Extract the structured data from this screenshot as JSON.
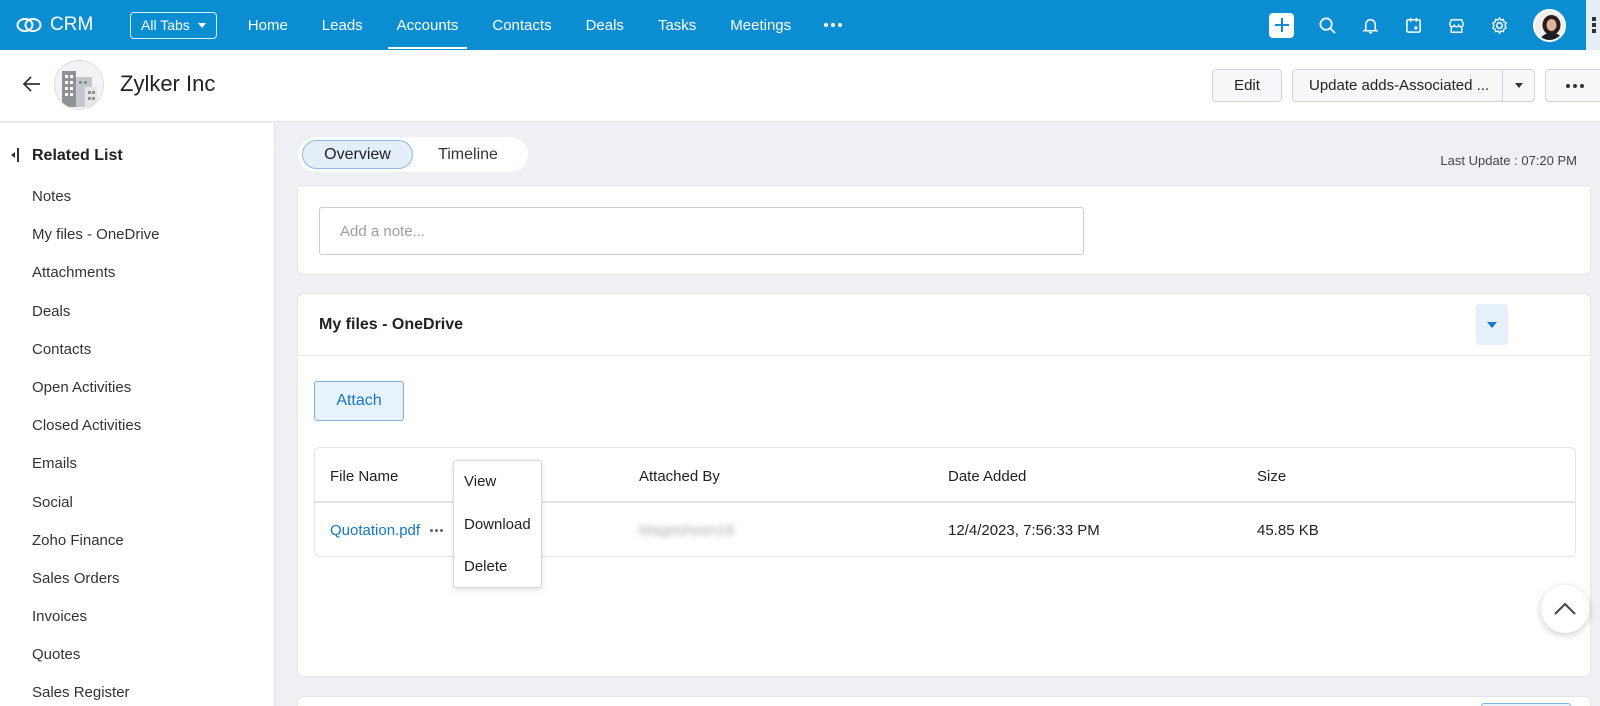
{
  "app": {
    "name": "CRM"
  },
  "nav": {
    "all_tabs": "All Tabs",
    "items": [
      "Home",
      "Leads",
      "Accounts",
      "Contacts",
      "Deals",
      "Tasks",
      "Meetings"
    ],
    "active": "Accounts"
  },
  "record": {
    "name": "Zylker Inc",
    "edit_label": "Edit",
    "update_label": "Update adds-Associated ..."
  },
  "sidebar": {
    "title": "Related List",
    "items": [
      "Notes",
      "My files - OneDrive",
      "Attachments",
      "Deals",
      "Contacts",
      "Open Activities",
      "Closed Activities",
      "Emails",
      "Social",
      "Zoho Finance",
      "Sales Orders",
      "Invoices",
      "Quotes",
      "Sales Register"
    ]
  },
  "tabs": {
    "overview": "Overview",
    "timeline": "Timeline"
  },
  "last_update": "Last Update : 07:20 PM",
  "note": {
    "placeholder": "Add a note..."
  },
  "files_section": {
    "title": "My files - OneDrive",
    "attach_label": "Attach",
    "columns": [
      "File Name",
      "Attached By",
      "Date Added",
      "Size"
    ],
    "rows": [
      {
        "file_name": "Quotation.pdf",
        "attached_by": "Magesheen18",
        "date_added": "12/4/2023, 7:56:33 PM",
        "size": "45.85 KB"
      }
    ]
  },
  "context_menu": [
    "View",
    "Download",
    "Delete"
  ],
  "colors": {
    "nav_bg": "#0b8ed1",
    "link": "#1677c9",
    "page_bg": "#eef0f4"
  }
}
